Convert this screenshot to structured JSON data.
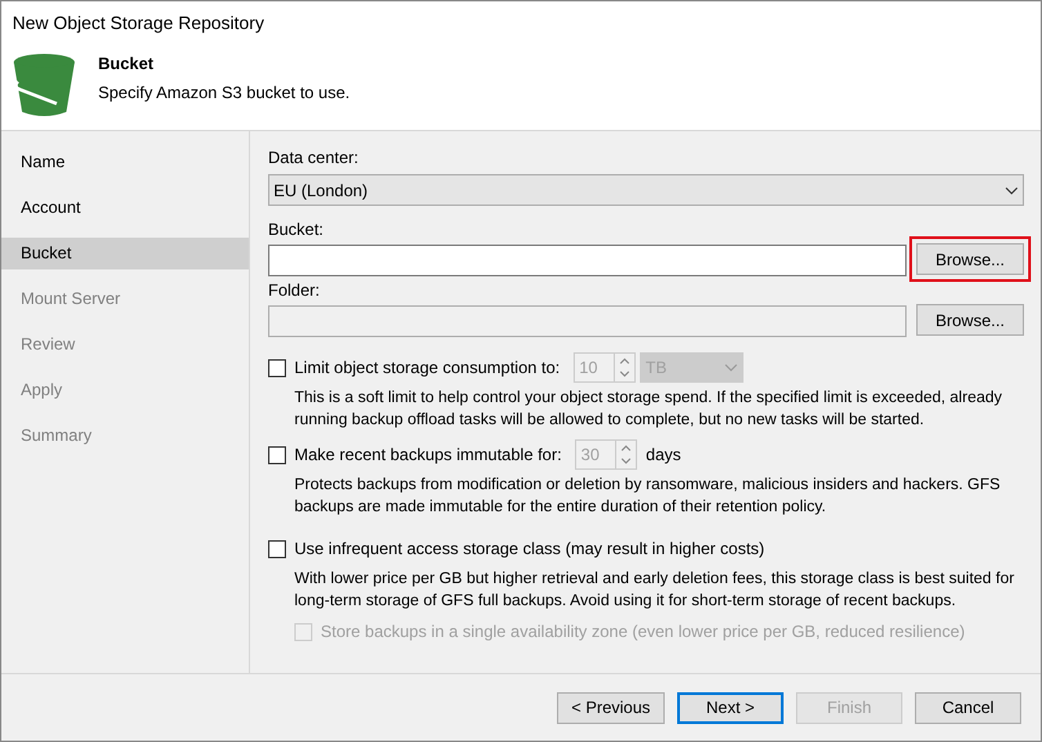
{
  "window": {
    "title": "New Object Storage Repository"
  },
  "header": {
    "title": "Bucket",
    "subtitle": "Specify Amazon S3 bucket to use."
  },
  "steps": [
    {
      "label": "Name",
      "selected": false,
      "disabled": false
    },
    {
      "label": "Account",
      "selected": false,
      "disabled": false
    },
    {
      "label": "Bucket",
      "selected": true,
      "disabled": false
    },
    {
      "label": "Mount Server",
      "selected": false,
      "disabled": true
    },
    {
      "label": "Review",
      "selected": false,
      "disabled": true
    },
    {
      "label": "Apply",
      "selected": false,
      "disabled": true
    },
    {
      "label": "Summary",
      "selected": false,
      "disabled": true
    }
  ],
  "data_center": {
    "label": "Data center:",
    "value": "EU (London)"
  },
  "bucket": {
    "label": "Bucket:",
    "disabled": false,
    "browse": {
      "label": "Browse...",
      "highlighted": true
    }
  },
  "folder": {
    "label": "Folder:",
    "disabled": true,
    "browse": {
      "label": "Browse...",
      "highlighted": false
    }
  },
  "options": [
    {
      "label": "Limit object storage consumption to:",
      "checked": false,
      "disabled": false,
      "spinner": "10",
      "unit": "TB",
      "description": "This is a soft limit to help control your object storage spend. If the specified limit is exceeded, already running backup offload tasks will be allowed to complete, but no new tasks will be started."
    },
    {
      "label": "Make recent backups immutable for:",
      "checked": false,
      "disabled": false,
      "spinner": "30",
      "suffix": "days",
      "description": "Protects backups from modification or deletion by ransomware, malicious insiders and hackers. GFS backups are made immutable for the entire duration of their retention policy."
    },
    {
      "label": "Use infrequent access storage class (may result in higher costs)",
      "checked": false,
      "disabled": false,
      "description": "With lower price per GB but higher retrieval and early deletion fees, this storage class is best suited for long-term storage of GFS full backups. Avoid using it for short-term storage of recent backups.",
      "sub": {
        "label": "Store backups in a single availability zone (even lower price per GB, reduced resilience)",
        "checked": false,
        "disabled": true
      }
    }
  ],
  "buttons": [
    {
      "label": "< Previous",
      "default": false,
      "disabled": false
    },
    {
      "label": "Next >",
      "default": true,
      "disabled": false
    },
    {
      "label": "Finish",
      "default": false,
      "disabled": true
    },
    {
      "label": "Cancel",
      "default": false,
      "disabled": false
    }
  ]
}
